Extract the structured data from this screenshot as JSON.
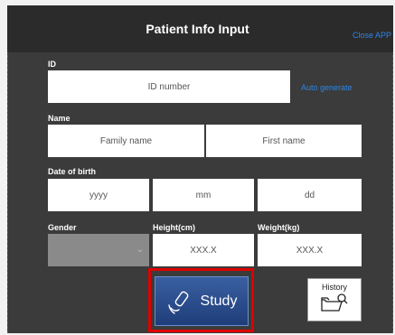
{
  "window": {
    "title": "Patient Info Input",
    "close_label": "Close APP"
  },
  "form": {
    "id": {
      "label": "ID",
      "placeholder": "ID number",
      "auto_generate_label": "Auto generate"
    },
    "name": {
      "label": "Name",
      "family_placeholder": "Family name",
      "first_placeholder": "First name"
    },
    "dob": {
      "label": "Date of birth",
      "year_placeholder": "yyyy",
      "month_placeholder": "mm",
      "day_placeholder": "dd"
    },
    "gender": {
      "label": "Gender",
      "value": ""
    },
    "height": {
      "label": "Height(cm)",
      "placeholder": "XXX.X"
    },
    "weight": {
      "label": "Weight(kg)",
      "placeholder": "XXX.X"
    }
  },
  "actions": {
    "study_label": "Study",
    "study_icon": "ultrasound-probe-icon",
    "history_label": "History",
    "history_icon": "folder-search-icon"
  },
  "colors": {
    "accent": "#2a86e8",
    "highlight": "#e00000",
    "study_button": "#2b4f8f"
  }
}
